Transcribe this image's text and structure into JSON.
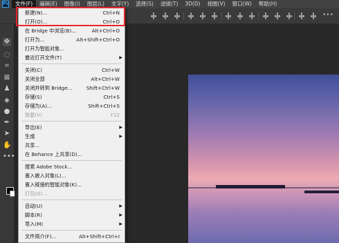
{
  "app": {
    "logo_text": "Ps"
  },
  "menubar": {
    "items": [
      {
        "label": "文件(F)",
        "active": true
      },
      {
        "label": "编辑(E)"
      },
      {
        "label": "图像(I)"
      },
      {
        "label": "图层(L)"
      },
      {
        "label": "文字(Y)"
      },
      {
        "label": "选择(S)"
      },
      {
        "label": "滤镜(T)"
      },
      {
        "label": "3D(D)"
      },
      {
        "label": "视图(V)"
      },
      {
        "label": "窗口(W)"
      },
      {
        "label": "帮助(H)"
      }
    ]
  },
  "optionsbar": {
    "more_glyph": "•••"
  },
  "file_menu": {
    "items": [
      {
        "label": "新建(N)...",
        "shortcut": "Ctrl+N"
      },
      {
        "label": "打开(O)...",
        "shortcut": "Ctrl+O"
      },
      {
        "label": "在 Bridge 中浏览(B)...",
        "shortcut": "Alt+Ctrl+O"
      },
      {
        "label": "打开为...",
        "shortcut": "Alt+Shift+Ctrl+O"
      },
      {
        "label": "打开为智能对象...",
        "shortcut": ""
      },
      {
        "label": "最近打开文件(T)",
        "shortcut": "",
        "submenu": true
      },
      {
        "label": "关闭(C)",
        "shortcut": "Ctrl+W"
      },
      {
        "label": "关闭全部",
        "shortcut": "Alt+Ctrl+W"
      },
      {
        "label": "关闭并转到 Bridge...",
        "shortcut": "Shift+Ctrl+W"
      },
      {
        "label": "存储(S)",
        "shortcut": "Ctrl+S"
      },
      {
        "label": "存储为(A)...",
        "shortcut": "Shift+Ctrl+S"
      },
      {
        "label": "恢复(V)",
        "shortcut": "F12",
        "disabled": true
      },
      {
        "label": "导出(E)",
        "shortcut": "",
        "submenu": true
      },
      {
        "label": "生成",
        "shortcut": "",
        "submenu": true
      },
      {
        "label": "共享...",
        "shortcut": ""
      },
      {
        "label": "在 Behance 上共享(D)...",
        "shortcut": ""
      },
      {
        "label": "搜索 Adobe Stock...",
        "shortcut": ""
      },
      {
        "label": "置入嵌入对象(L)...",
        "shortcut": ""
      },
      {
        "label": "置入链接的智能对象(K)...",
        "shortcut": ""
      },
      {
        "label": "打包(G)...",
        "shortcut": "",
        "disabled": true
      },
      {
        "label": "自动(U)",
        "shortcut": "",
        "submenu": true
      },
      {
        "label": "脚本(R)",
        "shortcut": "",
        "submenu": true
      },
      {
        "label": "导入(M)",
        "shortcut": "",
        "submenu": true
      },
      {
        "label": "文件简介(F)...",
        "shortcut": "Alt+Shift+Ctrl+I"
      }
    ],
    "submenu_arrow": "▶"
  },
  "colors": {
    "highlight_border": "#e8242b",
    "foreground_color": "#000000",
    "background_color": "#ffffff"
  },
  "tools": [
    {
      "name": "move-tool-icon",
      "glyph": "✥"
    },
    {
      "name": "lasso-tool-icon",
      "glyph": "◌"
    },
    {
      "name": "crop-tool-icon",
      "glyph": "⌗"
    },
    {
      "name": "frame-tool-icon",
      "glyph": "⊠"
    },
    {
      "name": "stamp-tool-icon",
      "glyph": "♟"
    },
    {
      "name": "eraser-tool-icon",
      "glyph": "◈"
    },
    {
      "name": "blur-tool-icon",
      "glyph": "●"
    },
    {
      "name": "pen-tool-icon",
      "glyph": "✒"
    },
    {
      "name": "path-select-tool-icon",
      "glyph": "➤"
    },
    {
      "name": "hand-tool-icon",
      "glyph": "✋"
    },
    {
      "name": "edit-toolbar-icon",
      "glyph": "•••"
    }
  ]
}
